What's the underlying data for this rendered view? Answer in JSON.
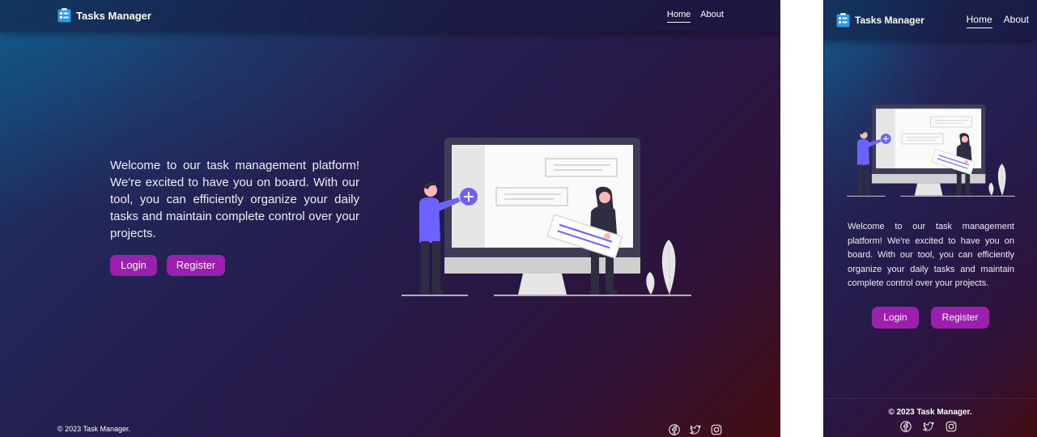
{
  "brand": {
    "title": "Tasks Manager",
    "icon": "clipboard-list-icon"
  },
  "nav": {
    "home": "Home",
    "about": "About"
  },
  "welcome": "Welcome to our task management platform! We're excited to have you on board. With our tool, you can efficiently organize your daily tasks and maintain complete control over your projects.",
  "buttons": {
    "login": "Login",
    "register": "Register"
  },
  "footer": {
    "copyright": "© 2023 Task Manager."
  },
  "social": [
    "facebook-icon",
    "twitter-icon",
    "instagram-icon"
  ],
  "colors": {
    "accent": "#9c1fae",
    "illustration_purple": "#6c63ff",
    "bg_top": "#0f4a78",
    "bg_bottom": "#440d12"
  }
}
